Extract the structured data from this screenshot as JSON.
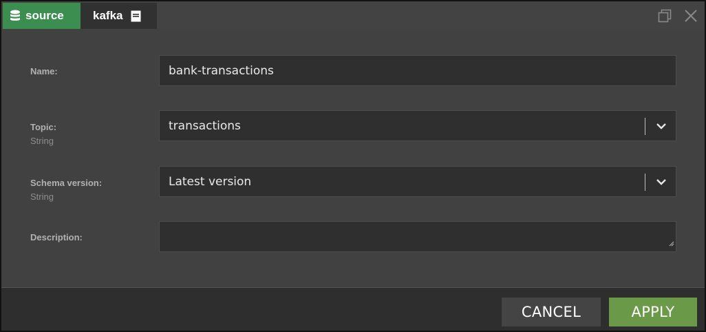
{
  "tabs": {
    "source_label": "source",
    "kafka_label": "kafka"
  },
  "form": {
    "name": {
      "label": "Name:",
      "value": "bank-transactions"
    },
    "topic": {
      "label": "Topic:",
      "type": "String",
      "value": "transactions"
    },
    "schema_version": {
      "label": "Schema version:",
      "type": "String",
      "value": "Latest version"
    },
    "description": {
      "label": "Description:",
      "value": ""
    }
  },
  "footer": {
    "cancel_label": "CANCEL",
    "apply_label": "APPLY"
  },
  "colors": {
    "source_tab": "#3c8d50",
    "apply_button": "#6a9a47",
    "cancel_button": "#444444"
  },
  "icons": {
    "source_tab": "database-icon",
    "kafka_tab": "document-icon",
    "window_maximize": "maximize-icon",
    "window_close": "close-icon",
    "select": "chevron-down-icon"
  }
}
